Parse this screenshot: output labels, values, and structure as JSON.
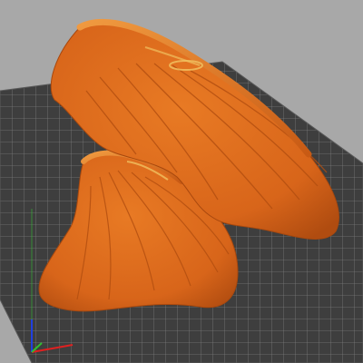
{
  "viewport": {
    "background_color": "#a8a8a8",
    "bed_color": "#3e3e3e",
    "bed_grid_color": "#7a7a7a",
    "model_color": "#e06a1a",
    "model_shade_color": "#b84f10",
    "model_highlight_color": "#f5a040",
    "model_layer_line_color": "#f0c060"
  },
  "axes": {
    "x_color": "#e02020",
    "y_color": "#30c030",
    "z_color": "#2040e0"
  },
  "icons": {
    "axis_gizmo": "xyz-axes-icon"
  }
}
